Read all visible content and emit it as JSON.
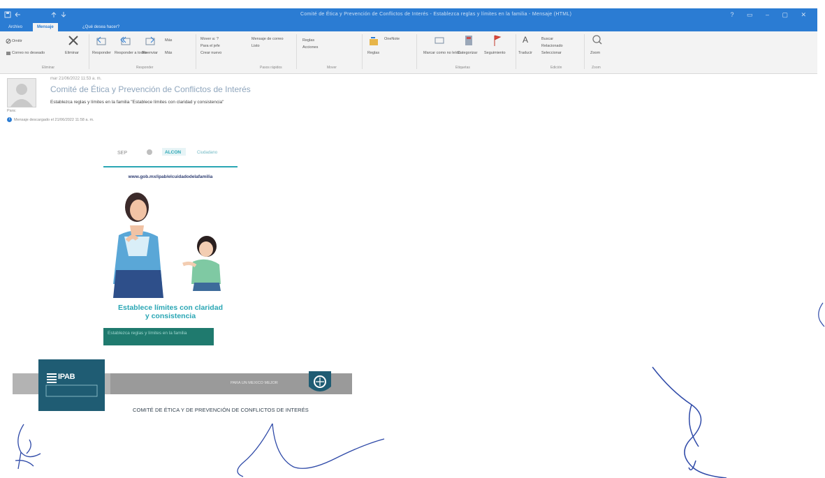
{
  "window": {
    "title": "Comité de Ética y Prevención de Conflictos de Interés - Establezca reglas y límites en la familia - Mensaje (HTML)",
    "controls": "? ▭ – ▢ ✕"
  },
  "tabs": [
    {
      "label": "Archivo"
    },
    {
      "label": "Mensaje",
      "active": true
    },
    {
      "label": "¿Qué desea hacer?"
    }
  ],
  "ribbon": {
    "groups": [
      {
        "name": "Eliminar"
      },
      {
        "name": "Responder"
      },
      {
        "name": "Pasos rápidos"
      },
      {
        "name": "Mover"
      },
      {
        "name": "Etiquetas"
      },
      {
        "name": "Edición"
      },
      {
        "name": "Zoom"
      }
    ],
    "buttons": {
      "ignore": "Omitir",
      "junk": "Correo no deseado",
      "delete": "Eliminar",
      "reply": "Responder",
      "reply_all": "Responder a todos",
      "forward": "Reenviar",
      "reply_more": "Más",
      "quick1": "Mover a: ?",
      "quick2": "Para el jefe",
      "quick3": "Crear nuevo",
      "quick4": "Mensaje de correo",
      "quick5": "Listo",
      "move_to": "Reglas",
      "onenote": "Acciones",
      "rules_small": "Reglas",
      "actions_small": "OneNote",
      "mark_unread": "Marcar como no leído",
      "categorize": "Categorizar",
      "follow_up": "Seguimiento",
      "translate": "Traducir",
      "find": "Buscar",
      "related": "Relacionado",
      "select": "Seleccionar",
      "zoom": "Zoom"
    }
  },
  "message": {
    "date": "mar 21/06/2022 11:53 a. m.",
    "sender": "Comité de Ética y Prevención de Conflictos de Interés",
    "subject": "Establezca reglas y límites en la familia \"Establece límites con claridad y consistencia\"",
    "to": "Para:",
    "info": "Mensaje descargado el 21/06/2022 11:58 a. m."
  },
  "poster": {
    "logos": "SEP | ALCON | Ciudadano",
    "url": "www.gob.mx/ipab/elcuidadodelafamilia",
    "slogan_line1": "Establece límites con claridad",
    "slogan_line2": "y consistencia",
    "banner": "Establezca reglas y límites en la familia"
  },
  "footer": {
    "logo_text": "IPAB",
    "band_text": "PARA UN MEXICO MEJOR",
    "committee": "COMITÉ DE ÉTICA Y DE PREVENCIÓN DE CONFLICTOS DE INTERÉS"
  },
  "colors": {
    "outlook_blue": "#2b7cd3",
    "poster_teal": "#2aa6b4",
    "banner_green": "#1f7a6e",
    "ipab_blue": "#1f5c73",
    "signature_blue": "#2f4aa8"
  }
}
